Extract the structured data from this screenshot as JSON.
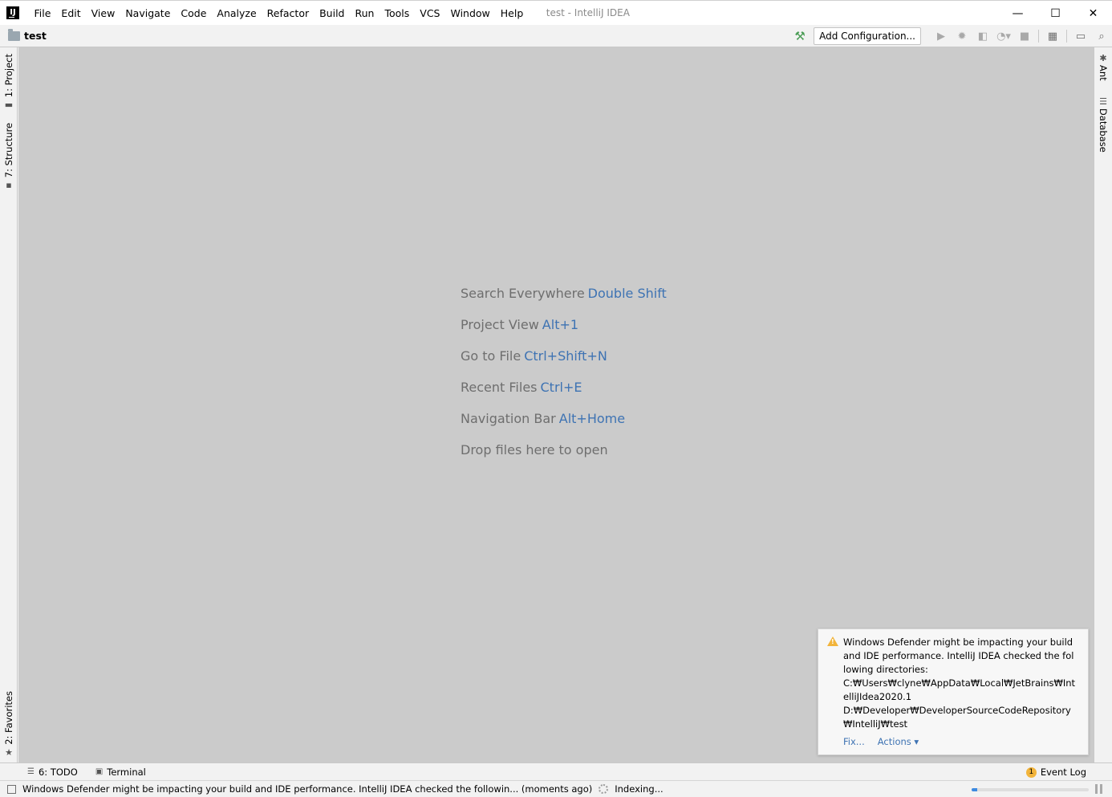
{
  "app": {
    "icon_text": "IJ",
    "window_title": "test - IntelliJ IDEA"
  },
  "menu": [
    "File",
    "Edit",
    "View",
    "Navigate",
    "Code",
    "Analyze",
    "Refactor",
    "Build",
    "Run",
    "Tools",
    "VCS",
    "Window",
    "Help"
  ],
  "window_controls": {
    "minimize": "—",
    "maximize": "☐",
    "close": "✕"
  },
  "toolbar": {
    "project_name": "test",
    "add_configuration_label": "Add Configuration...",
    "icons": [
      "hammer-icon",
      "run-icon",
      "debug-icon",
      "coverage-icon",
      "profile-icon",
      "stop-icon",
      "project-structure-icon",
      "sdk-icon",
      "search-icon"
    ]
  },
  "left_stripe": {
    "project_tab": "1: Project",
    "structure_tab": "7: Structure",
    "favorites_tab": "2: Favorites"
  },
  "right_stripe": {
    "ant_tab": "Ant",
    "database_tab": "Database"
  },
  "editor_hints": [
    {
      "text": "Search Everywhere",
      "shortcut": "Double Shift"
    },
    {
      "text": "Project View",
      "shortcut": "Alt+1"
    },
    {
      "text": "Go to File",
      "shortcut": "Ctrl+Shift+N"
    },
    {
      "text": "Recent Files",
      "shortcut": "Ctrl+E"
    },
    {
      "text": "Navigation Bar",
      "shortcut": "Alt+Home"
    },
    {
      "text": "Drop files here to open",
      "shortcut": ""
    }
  ],
  "notification": {
    "message": "Windows Defender might be impacting your build and IDE performance. IntelliJ IDEA checked the following directories:",
    "dir1": "C:₩Users₩clyne₩AppData₩Local₩JetBrains₩IntelliJIdea2020.1",
    "dir2": "D:₩Developer₩DeveloperSourceCodeRepository₩IntelliJ₩test",
    "fix_label": "Fix...",
    "actions_label": "Actions ▾"
  },
  "tool_windows": {
    "todo": "6: TODO",
    "terminal": "Terminal",
    "event_log": "Event Log",
    "event_log_count": "1"
  },
  "status_bar": {
    "message": "Windows Defender might be impacting your build and IDE performance. IntelliJ IDEA checked the followin... (moments ago)",
    "indexing": "Indexing...",
    "progress_fraction": 0.05
  }
}
